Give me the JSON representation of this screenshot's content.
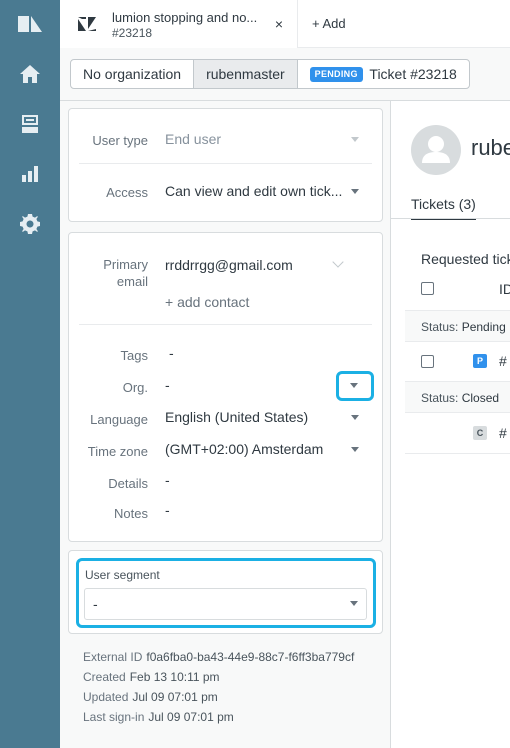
{
  "tab": {
    "title": "lumion stopping and no...",
    "subtitle": "#23218",
    "close": "×",
    "add": "+ Add"
  },
  "breadcrumb": {
    "organization": "No organization",
    "user": "rubenmaster",
    "status_badge": "PENDING",
    "ticket": "Ticket #23218"
  },
  "user_fields": {
    "user_type_label": "User type",
    "user_type_value": "End user",
    "access_label": "Access",
    "access_value": "Can view and edit own tick..."
  },
  "contact": {
    "primary_email_label_1": "Primary",
    "primary_email_label_2": "email",
    "primary_email_value": "rrddrrgg@gmail.com",
    "add_contact": "+ add contact"
  },
  "details": {
    "tags_label": "Tags",
    "tags_value": "-",
    "org_label": "Org.",
    "org_value": "-",
    "language_label": "Language",
    "language_value": "English (United States)",
    "timezone_label": "Time zone",
    "timezone_value": "(GMT+02:00) Amsterdam",
    "details_label": "Details",
    "details_value": "-",
    "notes_label": "Notes",
    "notes_value": "-"
  },
  "segment": {
    "label": "User segment",
    "value": "-"
  },
  "meta": {
    "external_id_label": "External ID",
    "external_id_value": "f0a6fba0-ba43-44e9-88c7-f6ff3ba779cf",
    "created_label": "Created",
    "created_value": "Feb 13 10:11 pm",
    "updated_label": "Updated",
    "updated_value": "Jul 09 07:01 pm",
    "last_signin_label": "Last sign-in",
    "last_signin_value": "Jul 09 07:01 pm"
  },
  "profile": {
    "name": "rube",
    "tickets_tab": "Tickets (3)",
    "requested_heading": "Requested tick",
    "id_column": "ID",
    "status_pending_label": "Status:",
    "status_pending_value": "Pending",
    "pending_badge": "P",
    "pending_ticket": "#",
    "status_closed_label": "Status:",
    "status_closed_value": "Closed",
    "closed_badge": "C",
    "closed_ticket": "#"
  },
  "colors": {
    "nav_bg": "#4a7a91",
    "highlight": "#1bb0e4",
    "pending_blue": "#3091ec"
  },
  "icons": [
    "zendesk-logo-icon",
    "home-icon",
    "views-icon",
    "reports-icon",
    "settings-icon",
    "user-avatar-icon"
  ]
}
